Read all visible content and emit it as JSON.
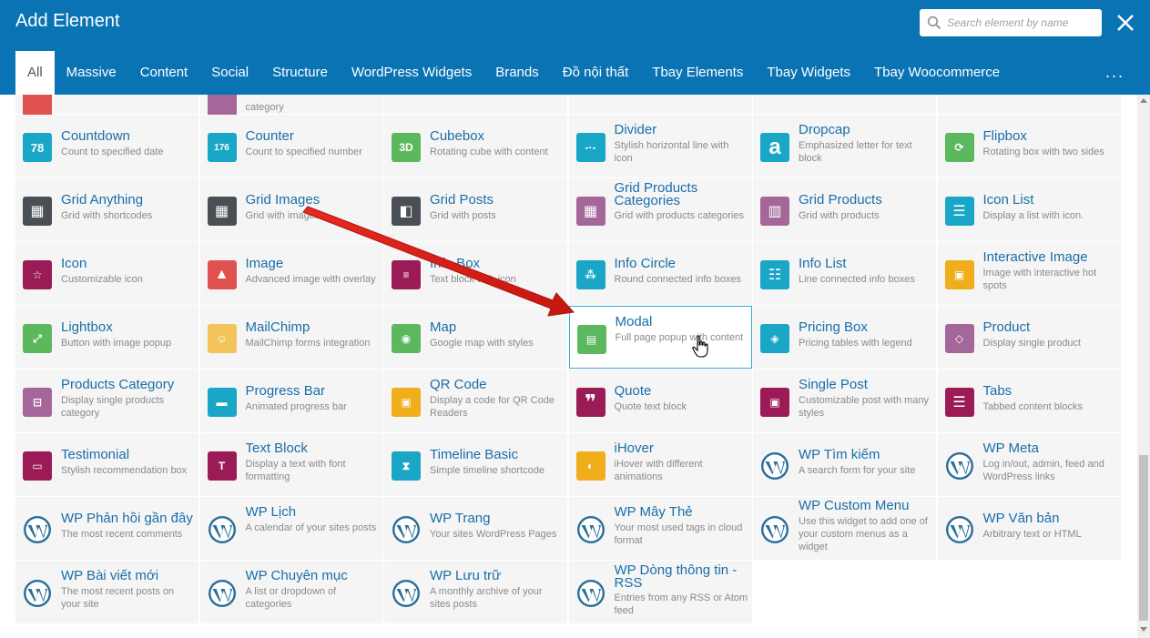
{
  "dialog": {
    "title": "Add Element",
    "search_placeholder": "Search element by name",
    "more_label": "...",
    "accent": "#0a73b4"
  },
  "tabs": [
    {
      "label": "All",
      "active": true
    },
    {
      "label": "Massive"
    },
    {
      "label": "Content"
    },
    {
      "label": "Social"
    },
    {
      "label": "Structure"
    },
    {
      "label": "WordPress Widgets"
    },
    {
      "label": "Brands"
    },
    {
      "label": "Đồ nội thất"
    },
    {
      "label": "Tbay Elements"
    },
    {
      "label": "Tbay Widgets"
    },
    {
      "label": "Tbay Woocommerce"
    }
  ],
  "partial_row": [
    {
      "desc": "category"
    }
  ],
  "elements": [
    {
      "title": "Countdown",
      "desc": "Count to specified date",
      "icon": "countdown-icon",
      "color": "#1aa6c7",
      "glyph": "78"
    },
    {
      "title": "Counter",
      "desc": "Count to specified number",
      "icon": "counter-icon",
      "color": "#1aa6c7",
      "glyph": "176"
    },
    {
      "title": "Cubebox",
      "desc": "Rotating cube with content",
      "icon": "cubebox-icon",
      "color": "#5cb85c",
      "glyph": "3D"
    },
    {
      "title": "Divider",
      "desc": "Stylish horizontal line with icon",
      "icon": "divider-icon",
      "color": "#1aa6c7",
      "glyph": "-·-"
    },
    {
      "title": "Dropcap",
      "desc": "Emphasized letter for text block",
      "icon": "dropcap-icon",
      "color": "#1aa6c7",
      "glyph": "a"
    },
    {
      "title": "Flipbox",
      "desc": "Rotating box with two sides",
      "icon": "flipbox-icon",
      "color": "#5cb85c",
      "glyph": "⟳"
    },
    {
      "title": "Grid Anything",
      "desc": "Grid with shortcodes",
      "icon": "grid-anything-icon",
      "color": "#4a4f55",
      "glyph": "▦"
    },
    {
      "title": "Grid Images",
      "desc": "Grid with images",
      "icon": "grid-images-icon",
      "color": "#4a4f55",
      "glyph": "▦"
    },
    {
      "title": "Grid Posts",
      "desc": "Grid with posts",
      "icon": "grid-posts-icon",
      "color": "#4a4f55",
      "glyph": "◧"
    },
    {
      "title": "Grid Products Categories",
      "desc": "Grid with products categories",
      "icon": "grid-products-categories-icon",
      "color": "#a5679a",
      "glyph": "▦"
    },
    {
      "title": "Grid Products",
      "desc": "Grid with products",
      "icon": "grid-products-icon",
      "color": "#a5679a",
      "glyph": "▥"
    },
    {
      "title": "Icon List",
      "desc": "Display a list with icon.",
      "icon": "icon-list-icon",
      "color": "#1aa6c7",
      "glyph": "☰"
    },
    {
      "title": "Icon",
      "desc": "Customizable icon",
      "icon": "star-icon",
      "color": "#9b1b56",
      "glyph": "☆"
    },
    {
      "title": "Image",
      "desc": "Advanced image with overlay",
      "icon": "image-icon",
      "color": "#e0524f",
      "glyph": "▲"
    },
    {
      "title": "Info Box",
      "desc": "Text block with icon",
      "icon": "info-box-icon",
      "color": "#9b1b56",
      "glyph": "≡"
    },
    {
      "title": "Info Circle",
      "desc": "Round connected info boxes",
      "icon": "info-circle-icon",
      "color": "#1aa6c7",
      "glyph": "⁂"
    },
    {
      "title": "Info List",
      "desc": "Line connected info boxes",
      "icon": "info-list-icon",
      "color": "#1aa6c7",
      "glyph": "☷"
    },
    {
      "title": "Interactive Image",
      "desc": "Image with interactive hot spots",
      "icon": "interactive-image-icon",
      "color": "#f0ad1c",
      "glyph": "▣"
    },
    {
      "title": "Lightbox",
      "desc": "Button with image popup",
      "icon": "lightbox-icon",
      "color": "#5cb85c",
      "glyph": "⤢"
    },
    {
      "title": "MailChimp",
      "desc": "MailChimp forms integration",
      "icon": "mailchimp-icon",
      "color": "#f2c45a",
      "glyph": "☺"
    },
    {
      "title": "Map",
      "desc": "Google map with styles",
      "icon": "map-pin-icon",
      "color": "#5cb85c",
      "glyph": "◉"
    },
    {
      "title": "Modal",
      "desc": "Full page popup with content",
      "icon": "modal-icon",
      "color": "#5cb85c",
      "glyph": "▤",
      "highlight": true
    },
    {
      "title": "Pricing Box",
      "desc": "Pricing tables with legend",
      "icon": "price-tag-icon",
      "color": "#1aa6c7",
      "glyph": "◈"
    },
    {
      "title": "Product",
      "desc": "Display single product",
      "icon": "product-tag-icon",
      "color": "#a5679a",
      "glyph": "◇"
    },
    {
      "title": "Products Category",
      "desc": "Display single products category",
      "icon": "shopping-bag-icon",
      "color": "#a5679a",
      "glyph": "⊟"
    },
    {
      "title": "Progress Bar",
      "desc": "Animated progress bar",
      "icon": "progress-bar-icon",
      "color": "#1aa6c7",
      "glyph": "▬"
    },
    {
      "title": "QR Code",
      "desc": "Display a code for QR Code Readers",
      "icon": "qr-code-icon",
      "color": "#f0ad1c",
      "glyph": "▣"
    },
    {
      "title": "Quote",
      "desc": "Quote text block",
      "icon": "quote-icon",
      "color": "#9b1b56",
      "glyph": "❞"
    },
    {
      "title": "Single Post",
      "desc": "Customizable post with many styles",
      "icon": "single-post-icon",
      "color": "#9b1b56",
      "glyph": "▣"
    },
    {
      "title": "Tabs",
      "desc": "Tabbed content blocks",
      "icon": "tabs-icon",
      "color": "#9b1b56",
      "glyph": "☰"
    },
    {
      "title": "Testimonial",
      "desc": "Stylish recommendation box",
      "icon": "speech-bubble-icon",
      "color": "#9b1b56",
      "glyph": "▭"
    },
    {
      "title": "Text Block",
      "desc": "Display a text with font formatting",
      "icon": "text-block-icon",
      "color": "#9b1b56",
      "glyph": "T"
    },
    {
      "title": "Timeline Basic",
      "desc": "Simple timeline shortcode",
      "icon": "hourglass-icon",
      "color": "#1aa6c7",
      "glyph": "⧗"
    },
    {
      "title": "iHover",
      "desc": "iHover with different animations",
      "icon": "ihover-icon",
      "color": "#f0ad1c",
      "glyph": "◐"
    },
    {
      "title": "WP Tìm kiếm",
      "desc": "A search form for your site",
      "icon": "wordpress-icon",
      "wp": true
    },
    {
      "title": "WP Meta",
      "desc": "Log in/out, admin, feed and WordPress links",
      "icon": "wordpress-icon",
      "wp": true
    },
    {
      "title": "WP Phản hồi gần đây",
      "desc": "The most recent comments",
      "icon": "wordpress-icon",
      "wp": true
    },
    {
      "title": "WP Lịch",
      "desc": "A calendar of your sites posts",
      "icon": "wordpress-icon",
      "wp": true
    },
    {
      "title": "WP Trang",
      "desc": "Your sites WordPress Pages",
      "icon": "wordpress-icon",
      "wp": true
    },
    {
      "title": "WP Mây Thẻ",
      "desc": "Your most used tags in cloud format",
      "icon": "wordpress-icon",
      "wp": true
    },
    {
      "title": "WP Custom Menu",
      "desc": "Use this widget to add one of your custom menus as a widget",
      "icon": "wordpress-icon",
      "wp": true
    },
    {
      "title": "WP Văn bản",
      "desc": "Arbitrary text or HTML",
      "icon": "wordpress-icon",
      "wp": true
    },
    {
      "title": "WP Bài viết mới",
      "desc": "The most recent posts on your site",
      "icon": "wordpress-icon",
      "wp": true
    },
    {
      "title": "WP Chuyên mục",
      "desc": "A list or dropdown of categories",
      "icon": "wordpress-icon",
      "wp": true
    },
    {
      "title": "WP Lưu trữ",
      "desc": "A monthly archive of your sites posts",
      "icon": "wordpress-icon",
      "wp": true
    },
    {
      "title": "WP Dòng thông tin - RSS",
      "desc": "Entries from any RSS or Atom feed",
      "icon": "wordpress-icon",
      "wp": true
    }
  ]
}
